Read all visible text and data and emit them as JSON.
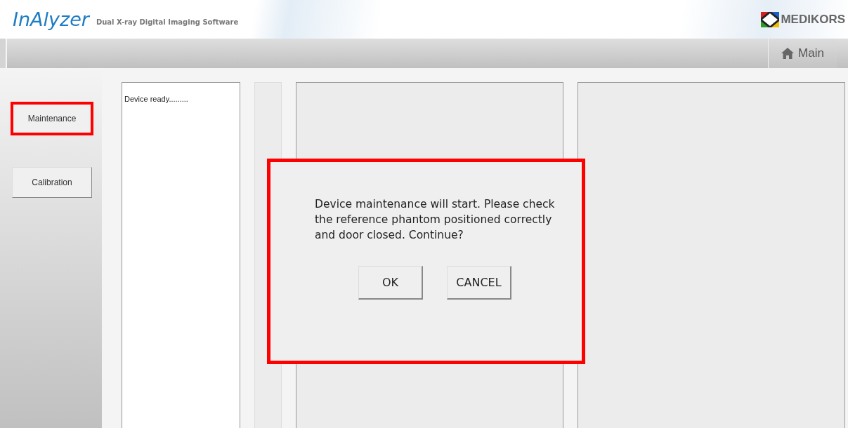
{
  "header": {
    "logo": "InAlyzer",
    "subtitle": "Dual X-ray Digital Imaging Software",
    "brand": "MEDIKORS"
  },
  "toolbar": {
    "main_button": "Main"
  },
  "side_buttons": [
    {
      "label": "Maintenance",
      "highlighted": true
    },
    {
      "label": "Calibration",
      "highlighted": false
    }
  ],
  "log": {
    "text": "Device ready........."
  },
  "dialog": {
    "message": "Device maintenance will start. Please check the reference phantom positioned correctly and door closed. Continue?",
    "highlighted": true,
    "buttons": [
      "OK",
      "CANCEL"
    ]
  }
}
